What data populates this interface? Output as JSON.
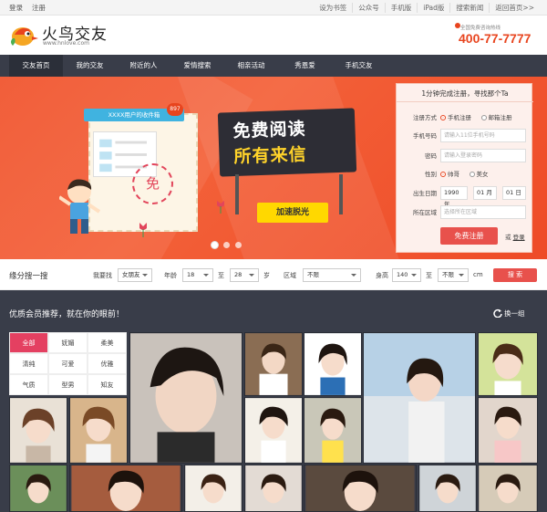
{
  "topbar": {
    "left": [
      "登录",
      "注册"
    ],
    "right": [
      "设为书签",
      "公众号",
      "手机版",
      "iPad版",
      "搜索新闻",
      "返回首页>>"
    ]
  },
  "header": {
    "brand": "火鸟交友",
    "domain": "www.hnlove.com",
    "hotline_label": "全国免费咨询热线",
    "hotline": "400-77-7777"
  },
  "nav": {
    "items": [
      "交友首页",
      "我的交友",
      "附近的人",
      "爱情搜索",
      "相亲活动",
      "秀恩爱",
      "手机交友"
    ]
  },
  "banner": {
    "inbox_label": "XXXX用户的收件箱",
    "inbox_count": "897",
    "stamp": "免",
    "headline1": "免费阅读",
    "headline2": "所有来信",
    "cta": "加速脱光"
  },
  "register": {
    "title": "1分钟完成注册，寻找那个Ta",
    "method_label": "注册方式",
    "method_options": [
      "手机注册",
      "邮箱注册"
    ],
    "phone_label": "手机号码",
    "phone_placeholder": "请输入11位手机号码",
    "password_label": "密码",
    "password_placeholder": "请输入登录密码",
    "gender_label": "性别",
    "gender_options": [
      "帅哥",
      "美女"
    ],
    "birthday_label": "出生日期",
    "birth_year": "1990 年",
    "birth_month": "01 月",
    "birth_day": "01 日",
    "area_label": "所在区域",
    "area_placeholder": "选择所在区域",
    "submit": "免费注册",
    "or": "或",
    "login": "登录"
  },
  "search": {
    "title": "缘分搜一搜",
    "looking_label": "我要找",
    "looking_value": "女朋友",
    "age_label": "年龄",
    "age_from": "18",
    "to1": "至",
    "age_to": "28",
    "age_unit": "岁",
    "region_label": "区域",
    "region_value": "不限",
    "height_label": "身高",
    "height_from": "140",
    "to2": "至",
    "height_to": "不限",
    "height_unit": "cm",
    "button": "搜 索"
  },
  "members": {
    "title": "优质会员推荐，就在你的眼前！",
    "refresh": "换一组",
    "filters": [
      "全部",
      "妩媚",
      "柔美",
      "清纯",
      "可爱",
      "优雅",
      "气质",
      "型男",
      "知友"
    ],
    "active_filter": "全部"
  },
  "colors": {
    "accent": "#e8441e",
    "nav_bg": "#393d49",
    "filter_active": "#e44061",
    "banner_bg": "#f0512a",
    "cta": "#ffd800"
  }
}
